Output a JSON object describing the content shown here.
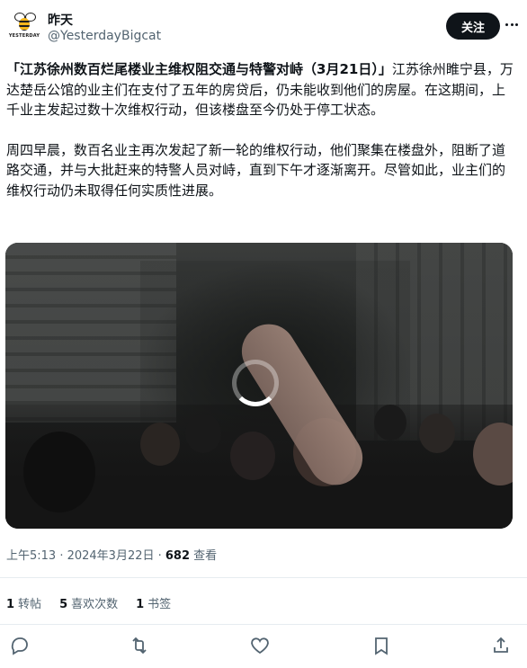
{
  "author": {
    "name": "昨天",
    "handle": "@YesterdayBigcat",
    "avatar_text": "YESTERDAY"
  },
  "follow_label": "关注",
  "tweet": {
    "title": "「江苏徐州数百烂尾楼业主维权阻交通与特警对峙（3月21日）」",
    "paragraph1_rest": "江苏徐州睢宁县，万达楚岳公馆的业主们在支付了五年的房贷后，仍未能收到他们的房屋。在这期间，上千业主发起过数十次维权行动，但该楼盘至今仍处于停工状态。",
    "paragraph2": "周四早晨，数百名业主再次发起了新一轮的维权行动，他们聚集在楼盘外，阻断了道路交通，并与大批赶来的特警人员对峙，直到下午才逐渐离开。尽管如此，业主们的维权行动仍未取得任何实质性进展。"
  },
  "meta": {
    "time": "上午5:13 · 2024年3月22日 · ",
    "views": "682",
    "views_label": " 查看"
  },
  "stats": {
    "retweets_count": "1",
    "retweets_label": "转帖",
    "likes_count": "5",
    "likes_label": "喜欢次数",
    "bookmarks_count": "1",
    "bookmarks_label": "书签"
  },
  "icons": {
    "reply": "reply-icon",
    "retweet": "retweet-icon",
    "like": "heart-icon",
    "bookmark": "bookmark-icon",
    "share": "share-icon",
    "more": "more-icon"
  }
}
